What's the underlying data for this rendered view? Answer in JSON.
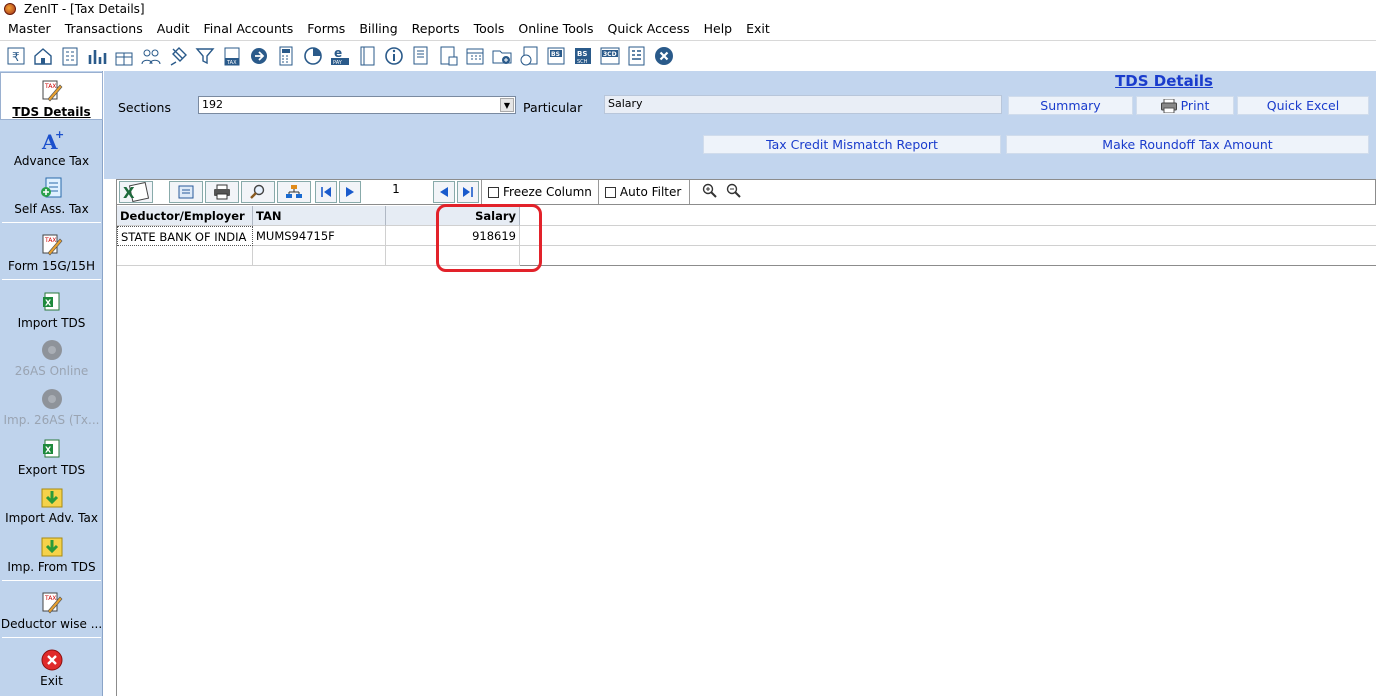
{
  "window": {
    "title": "ZenIT - [Tax Details]"
  },
  "menu": [
    "Master",
    "Transactions",
    "Audit",
    "Final Accounts",
    "Forms",
    "Billing",
    "Reports",
    "Tools",
    "Online Tools",
    "Quick Access",
    "Help",
    "Exit"
  ],
  "toolbar_icons": [
    "rupee-icon",
    "home-icon",
    "building-icon",
    "bar-chart-icon",
    "gift-icon",
    "people-icon",
    "pin-icon",
    "filter-icon",
    "tax-icon",
    "shield-icon",
    "calculator-icon",
    "pie-icon",
    "epay-icon",
    "book-icon",
    "info-icon",
    "sheet-icon",
    "sheet-stats-icon",
    "calendar-icon",
    "folder-add-icon",
    "document-icon",
    "bs-icon",
    "bs-sch-icon",
    "3cd-icon",
    "form-icon",
    "close-circle-icon"
  ],
  "sidebar": {
    "items": [
      {
        "label": "TDS Details",
        "icon": "tax-pencil-icon"
      },
      {
        "label": "Advance Tax",
        "icon": "a-plus-icon"
      },
      {
        "label": "Self Ass. Tax",
        "icon": "add-sheet-icon"
      },
      {
        "label": "Form 15G/15H",
        "icon": "tax-pencil-icon"
      },
      {
        "label": "Import TDS",
        "icon": "excel-icon"
      },
      {
        "label": "26AS Online",
        "icon": "gear-blob-icon"
      },
      {
        "label": "Imp. 26AS (Tx...",
        "icon": "gear-blob-icon"
      },
      {
        "label": "Export TDS",
        "icon": "excel-icon"
      },
      {
        "label": "Import Adv. Tax",
        "icon": "import-arrow-icon"
      },
      {
        "label": "Imp. From TDS",
        "icon": "import-arrow-icon"
      },
      {
        "label": "Deductor wise ...",
        "icon": "tax-pencil-icon"
      },
      {
        "label": "Exit",
        "icon": "exit-icon"
      }
    ]
  },
  "form": {
    "title": "TDS Details",
    "sections_label": "Sections",
    "sections_value": "192",
    "particular_label": "Particular",
    "particular_value": "Salary",
    "summary_label": "Summary",
    "print_label": "Print",
    "quick_excel_label": "Quick Excel",
    "tax_credit_label": "Tax Credit Mismatch Report",
    "roundoff_label": "Make Roundoff Tax Amount"
  },
  "gridbar": {
    "page_number": "1",
    "freeze_label": "Freeze Column",
    "autofilter_label": "Auto Filter"
  },
  "grid": {
    "columns": [
      "Deductor/Employer",
      "TAN",
      "",
      "Salary"
    ],
    "rows": [
      [
        "STATE BANK OF INDIA",
        "MUMS94715F",
        "",
        "918619"
      ],
      [
        "",
        "",
        "",
        ""
      ]
    ]
  },
  "colors": {
    "panel": "#c2d5ee",
    "title_blue": "#1a3ccc",
    "highlight": "#e2222a"
  }
}
